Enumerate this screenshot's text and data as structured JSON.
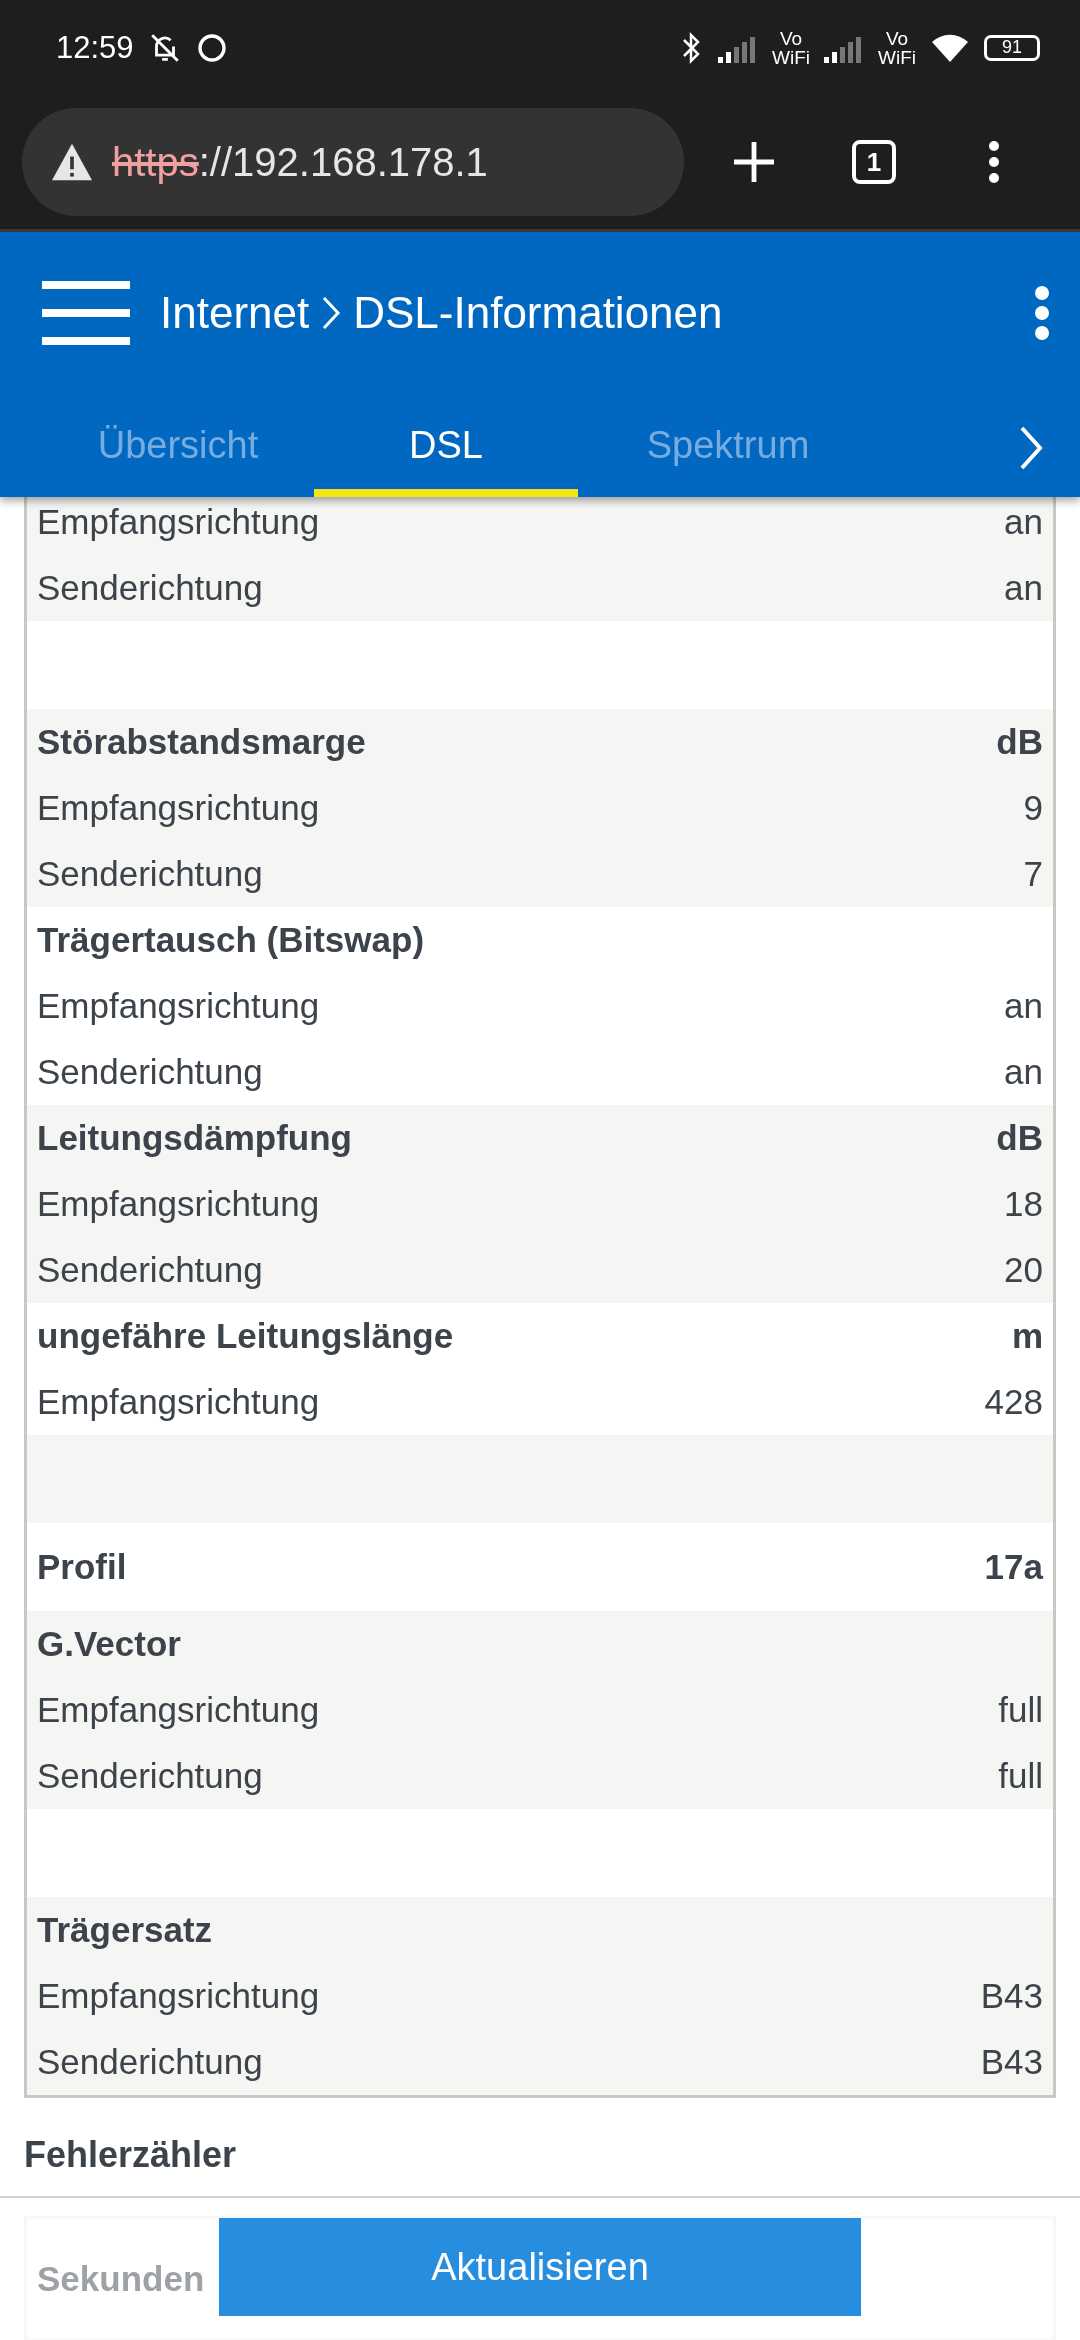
{
  "status_bar": {
    "time": "12:59",
    "vowifi": [
      {
        "top": "Vo",
        "bottom": "WiFi"
      },
      {
        "top": "Vo",
        "bottom": "WiFi"
      }
    ],
    "battery": "91"
  },
  "browser": {
    "scheme": "https",
    "rest": "://192.168.178.1",
    "tab_count": "1"
  },
  "header": {
    "breadcrumb": [
      {
        "label": "Internet"
      },
      {
        "label": "DSL-Informationen"
      }
    ]
  },
  "tabs": [
    {
      "label": "Übersicht",
      "selected": false
    },
    {
      "label": "DSL",
      "selected": true
    },
    {
      "label": "Spektrum",
      "selected": false
    }
  ],
  "table": {
    "groups": [
      {
        "kind": "group",
        "rows": [
          {
            "label": "Empfangsrichtung",
            "value": "an"
          },
          {
            "label": "Senderichtung",
            "value": "an"
          }
        ]
      },
      {
        "kind": "spacer"
      },
      {
        "kind": "group",
        "title": "Störabstandsmarge",
        "unit": "dB",
        "rows": [
          {
            "label": "Empfangsrichtung",
            "value": "9"
          },
          {
            "label": "Senderichtung",
            "value": "7"
          }
        ]
      },
      {
        "kind": "group",
        "title": "Trägertausch (Bitswap)",
        "rows": [
          {
            "label": "Empfangsrichtung",
            "value": "an"
          },
          {
            "label": "Senderichtung",
            "value": "an"
          }
        ]
      },
      {
        "kind": "group",
        "title": "Leitungsdämpfung",
        "unit": "dB",
        "rows": [
          {
            "label": "Empfangsrichtung",
            "value": "18"
          },
          {
            "label": "Senderichtung",
            "value": "20"
          }
        ]
      },
      {
        "kind": "group",
        "title": "ungefähre Leitungslänge",
        "unit": "m",
        "rows": [
          {
            "label": "Empfangsrichtung",
            "value": "428"
          }
        ]
      },
      {
        "kind": "spacer"
      },
      {
        "kind": "group",
        "title": "Profil",
        "unit": "17a"
      },
      {
        "kind": "group",
        "title": "G.Vector",
        "rows": [
          {
            "label": "Empfangsrichtung",
            "value": "full"
          },
          {
            "label": "Senderichtung",
            "value": "full"
          }
        ]
      },
      {
        "kind": "spacer"
      },
      {
        "kind": "group",
        "title": "Trägersatz",
        "rows": [
          {
            "label": "Empfangsrichtung",
            "value": "B43"
          },
          {
            "label": "Senderichtung",
            "value": "B43"
          }
        ]
      }
    ]
  },
  "next_section": {
    "title": "Fehlerzähler",
    "first_row": "Sekunden"
  },
  "footer": {
    "button": "Aktualisieren"
  }
}
